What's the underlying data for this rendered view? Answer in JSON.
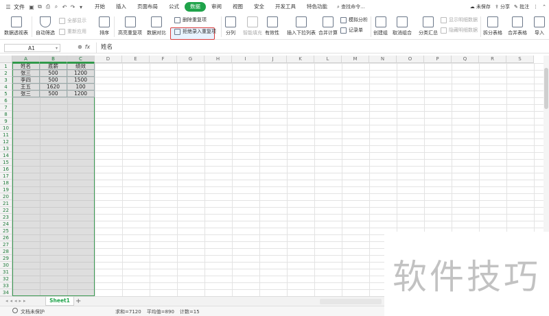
{
  "menubar": {
    "file": "文件",
    "tabs": [
      "开始",
      "插入",
      "页面布局",
      "公式",
      "数据",
      "审阅",
      "视图",
      "安全",
      "开发工具",
      "特色功能"
    ],
    "active_tab": "数据",
    "search": "查找命令...",
    "unsaved": "未保存",
    "share": "分享",
    "comment": "批注"
  },
  "ribbon": {
    "pivot": "数据透视表",
    "autofilter": "自动筛选",
    "showall": "全部显示",
    "reapply": "重新应用",
    "sort": "排序",
    "highlight_dup": "高亮重复项",
    "remove_dup": "删除重复项",
    "compare": "数据对比",
    "reject_dup": "拒绝录入重复项",
    "split": "分列",
    "smartfill": "智能填充",
    "validity": "有效性",
    "dropdown": "插入下拉列表",
    "consolidate": "合并计算",
    "whatif": "模拟分析",
    "record": "记录单",
    "group": "创建组",
    "ungroup": "取消组合",
    "subtotal": "分类汇总",
    "showdetail": "显示明细数据",
    "hidedetail": "隐藏明细数据",
    "splittable": "拆分表格",
    "mergetable": "合并表格",
    "import": "导入"
  },
  "formula_bar": {
    "cell_ref": "A1",
    "fx": "fx",
    "content": "姓名"
  },
  "columns": [
    "A",
    "B",
    "C",
    "D",
    "E",
    "F",
    "G",
    "H",
    "I",
    "J",
    "K",
    "L",
    "M",
    "N",
    "O",
    "P",
    "Q",
    "R",
    "S"
  ],
  "rows": [
    "1",
    "2",
    "3",
    "4",
    "5",
    "6",
    "7",
    "8",
    "9",
    "10",
    "11",
    "12",
    "13",
    "14",
    "15",
    "16",
    "17",
    "18",
    "19",
    "20",
    "21",
    "22",
    "23",
    "24",
    "25",
    "26",
    "27",
    "28",
    "29",
    "30",
    "31",
    "32",
    "33",
    "34"
  ],
  "table": [
    [
      "姓名",
      "底薪",
      "绩效"
    ],
    [
      "张三",
      "500",
      "1200"
    ],
    [
      "李四",
      "500",
      "1500"
    ],
    [
      "王五",
      "1620",
      "100"
    ],
    [
      "张三",
      "500",
      "1200"
    ]
  ],
  "sheet": {
    "name": "Sheet1",
    "add": "+"
  },
  "status": {
    "protect": "文档未保护",
    "sum": "求和=7120",
    "avg": "平均值=890",
    "count": "计数=15"
  },
  "watermark": "软件技巧"
}
